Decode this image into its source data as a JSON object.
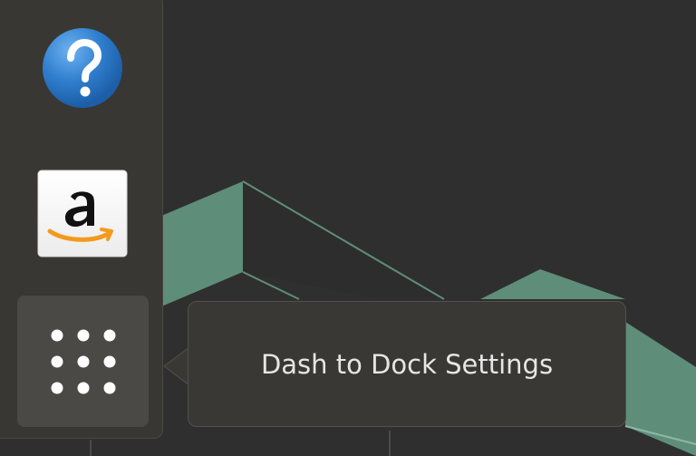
{
  "dock": {
    "launchers": [
      {
        "icon": "help-icon"
      },
      {
        "icon": "amazon-icon"
      },
      {
        "icon": "show-applications-grid-icon",
        "state": "hovered"
      }
    ]
  },
  "tooltip": {
    "text": "Dash to Dock Settings"
  },
  "colors": {
    "desktop_background": "#2f2f2f",
    "wallpaper_accent": "#5e8e7a",
    "dock_background": "#383733",
    "tooltip_background": "#393834",
    "tooltip_text": "#e6e6e6"
  }
}
